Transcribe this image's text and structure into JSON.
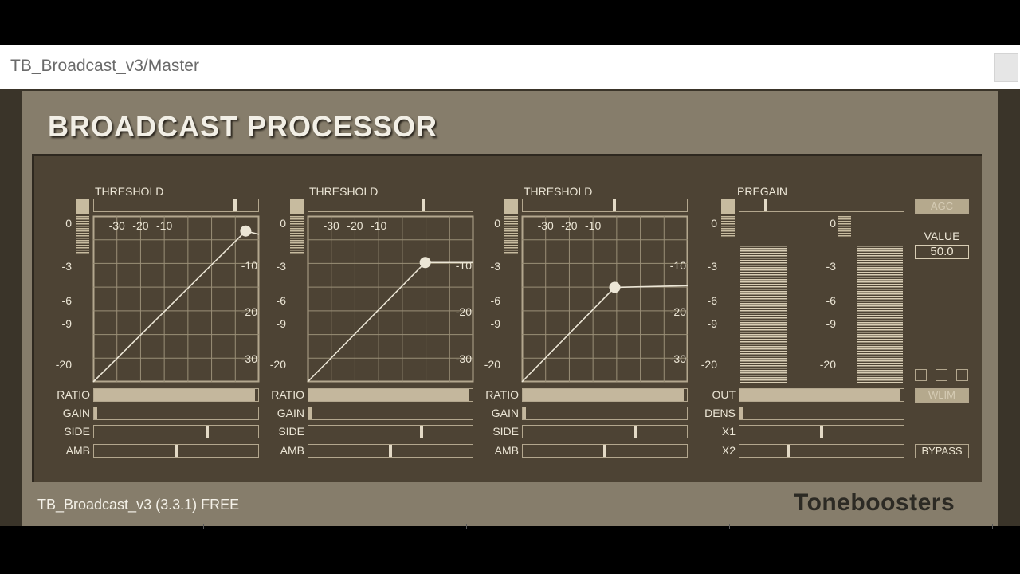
{
  "window": {
    "title": "TB_Broadcast_v3/Master"
  },
  "plugin": {
    "title": "BROADCAST PROCESSOR",
    "footer": "TB_Broadcast_v3 (3.3.1) FREE",
    "brand": "Toneboosters"
  },
  "meter_scale": [
    "0",
    "-3",
    "-6",
    "-9",
    "-20"
  ],
  "graph_scale": {
    "top": [
      "-30",
      "-20",
      "-10"
    ],
    "right": [
      "-10",
      "-20",
      "-30"
    ]
  },
  "bands": [
    {
      "threshold_label": "THRESHOLD",
      "threshold": 0.86,
      "ratio": 0.98,
      "gain": 0.0,
      "side": 0.69,
      "amb": 0.5,
      "labels": {
        "ratio": "RATIO",
        "gain": "GAIN",
        "side": "SIDE",
        "amb": "AMB"
      },
      "curve": {
        "knee": [
          0.92,
          0.09
        ],
        "end_y": 0.11
      }
    },
    {
      "threshold_label": "THRESHOLD",
      "threshold": 0.7,
      "ratio": 0.98,
      "gain": 0.0,
      "side": 0.69,
      "amb": 0.5,
      "labels": {
        "ratio": "RATIO",
        "gain": "GAIN",
        "side": "SIDE",
        "amb": "AMB"
      },
      "curve": {
        "knee": [
          0.71,
          0.28
        ],
        "end_y": 0.28
      }
    },
    {
      "threshold_label": "THRESHOLD",
      "threshold": 0.56,
      "ratio": 0.98,
      "gain": 0.0,
      "side": 0.69,
      "amb": 0.5,
      "labels": {
        "ratio": "RATIO",
        "gain": "GAIN",
        "side": "SIDE",
        "amb": "AMB"
      },
      "curve": {
        "knee": [
          0.56,
          0.43
        ],
        "end_y": 0.42
      }
    }
  ],
  "output": {
    "pregain_label": "PREGAIN",
    "pregain": 0.16,
    "labels": {
      "out": "OUT",
      "dens": "DENS",
      "x1": "X1",
      "x2": "X2"
    },
    "out": 0.98,
    "dens": 0.0,
    "x1": 0.5,
    "x2": 0.3,
    "meter_levels": [
      0.85,
      0.85
    ]
  },
  "controls": {
    "agc": "AGC",
    "value_label": "VALUE",
    "value": "50.0",
    "wlim": "WLIM",
    "bypass": "BYPASS"
  },
  "colors": {
    "panel": "#4d4334",
    "frame": "#867d6b",
    "line": "#ece6d6",
    "accent": "#c7bb9f"
  }
}
